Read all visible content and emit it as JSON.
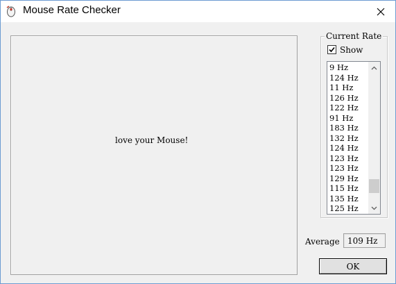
{
  "window": {
    "title": "Mouse Rate Checker",
    "icon": "mouse-icon",
    "close_icon": "close-icon"
  },
  "canvas": {
    "message": "love your Mouse!"
  },
  "current_rate": {
    "group_label": "Current Rate",
    "show_checkbox": {
      "label": "Show",
      "checked": true
    },
    "rates": [
      "9 Hz",
      "124 Hz",
      "11 Hz",
      "126 Hz",
      "122 Hz",
      "91 Hz",
      "183 Hz",
      "132 Hz",
      "124 Hz",
      "123 Hz",
      "123 Hz",
      "129 Hz",
      "115 Hz",
      "135 Hz",
      "125 Hz"
    ],
    "scroll_position": 0.92
  },
  "average": {
    "label": "Average",
    "value": "109 Hz"
  },
  "buttons": {
    "ok": "OK"
  },
  "colors": {
    "window_border": "#6b9bd2",
    "face": "#f0f0f0",
    "scroll_thumb": "#cdcdcd"
  }
}
